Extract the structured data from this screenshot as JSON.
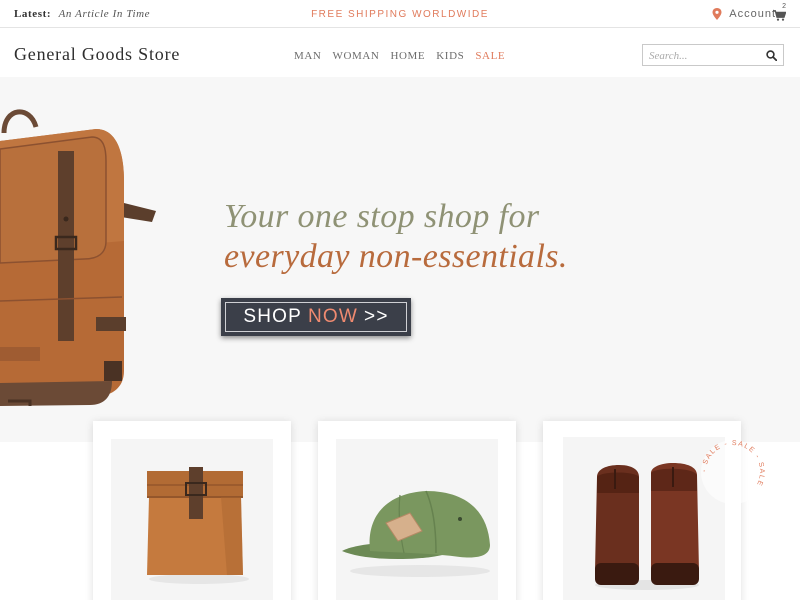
{
  "topbar": {
    "latest_label": "Latest:",
    "latest_article": "An Article In Time",
    "shipping": "FREE SHIPPING WORLDWIDE",
    "account_label": "Account",
    "cart_count": "2"
  },
  "header": {
    "logo": "General Goods Store",
    "nav": [
      "MAN",
      "WOMAN",
      "HOME",
      "KIDS",
      "SALE"
    ],
    "search_placeholder": "Search..."
  },
  "hero": {
    "tagline_line1": "Your one stop shop for",
    "tagline_line2": "everyday non-essentials.",
    "button_shop": "SHOP",
    "button_now": "NOW",
    "button_arrows": ">>"
  },
  "products": [
    {
      "name": "paper-bag-icon"
    },
    {
      "name": "cap-icon"
    },
    {
      "name": "boots-icon"
    }
  ],
  "sale_stamp": "- SALE - SALE - SALE",
  "colors": {
    "accent": "#e07b5c",
    "tagline_green": "#8f9275",
    "tagline_brown": "#b86b3d",
    "button_bg": "#3b3f49"
  }
}
